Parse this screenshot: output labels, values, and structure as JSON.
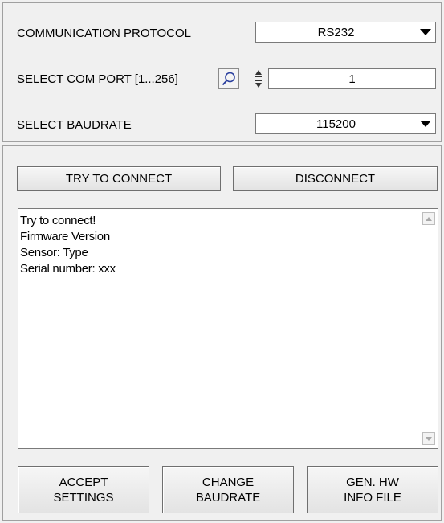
{
  "connection": {
    "protocol_label": "COMMUNICATION PROTOCOL",
    "protocol_value": "RS232",
    "com_port_label": "SELECT COM PORT [1...256]",
    "com_port_value": "1",
    "baudrate_label": "SELECT BAUDRATE",
    "baudrate_value": "115200"
  },
  "buttons": {
    "try_connect": "TRY TO CONNECT",
    "disconnect": "DISCONNECT",
    "accept_settings_line1": "ACCEPT",
    "accept_settings_line2": "SETTINGS",
    "change_baudrate_line1": "CHANGE",
    "change_baudrate_line2": "BAUDRATE",
    "gen_hw_line1": "GEN. HW",
    "gen_hw_line2": "INFO FILE"
  },
  "log": {
    "lines": [
      "Try to connect!",
      "Firmware Version",
      "Sensor: Type",
      "Serial number: xxx"
    ]
  },
  "icons": {
    "dropdown": "chevron-down-icon",
    "search": "search-icon",
    "spinner_up": "spin-up-icon",
    "spinner_down": "spin-down-icon",
    "scroll_up": "scroll-up-icon",
    "scroll_down": "scroll-down-icon"
  }
}
